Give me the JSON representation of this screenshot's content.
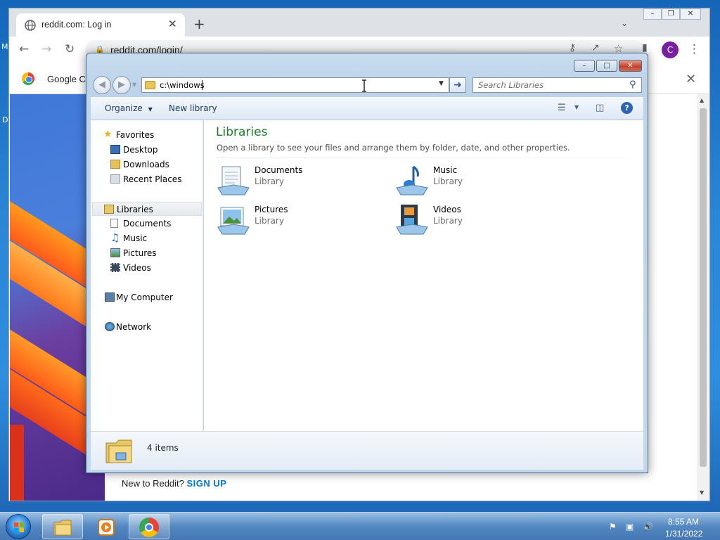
{
  "browser": {
    "tab_title": "reddit.com: Log in",
    "new_tab_symbol": "+",
    "tab_close_symbol": "✕",
    "url": "reddit.com/login/",
    "profile_initial": "C",
    "bookmark_label": "Google Cl",
    "page_text_prefix": "New to Reddit?",
    "page_text_link": "SIGN UP",
    "edge_letters": [
      "M",
      "D"
    ]
  },
  "explorer": {
    "address_value": "c:\\windows",
    "search_placeholder": "Search Libraries",
    "commands": {
      "organize": "Organize",
      "new_library": "New library"
    },
    "nav": {
      "favorites": "Favorites",
      "desktop": "Desktop",
      "downloads": "Downloads",
      "recent_places": "Recent Places",
      "libraries": "Libraries",
      "documents": "Documents",
      "music": "Music",
      "pictures": "Pictures",
      "videos": "Videos",
      "my_computer": "My Computer",
      "network": "Network"
    },
    "content": {
      "title": "Libraries",
      "subtitle": "Open a library to see your files and arrange them by folder, date, and other properties.",
      "items": [
        {
          "name": "Documents",
          "kind": "Library"
        },
        {
          "name": "Music",
          "kind": "Library"
        },
        {
          "name": "Pictures",
          "kind": "Library"
        },
        {
          "name": "Videos",
          "kind": "Library"
        }
      ]
    },
    "status": "4 items"
  },
  "taskbar": {
    "time": "8:55 AM",
    "date": "1/31/2022"
  },
  "colors": {
    "library_title": "#1e7a2c",
    "reddit_link": "#0079d3",
    "profile_avatar": "#7b1fa2"
  }
}
